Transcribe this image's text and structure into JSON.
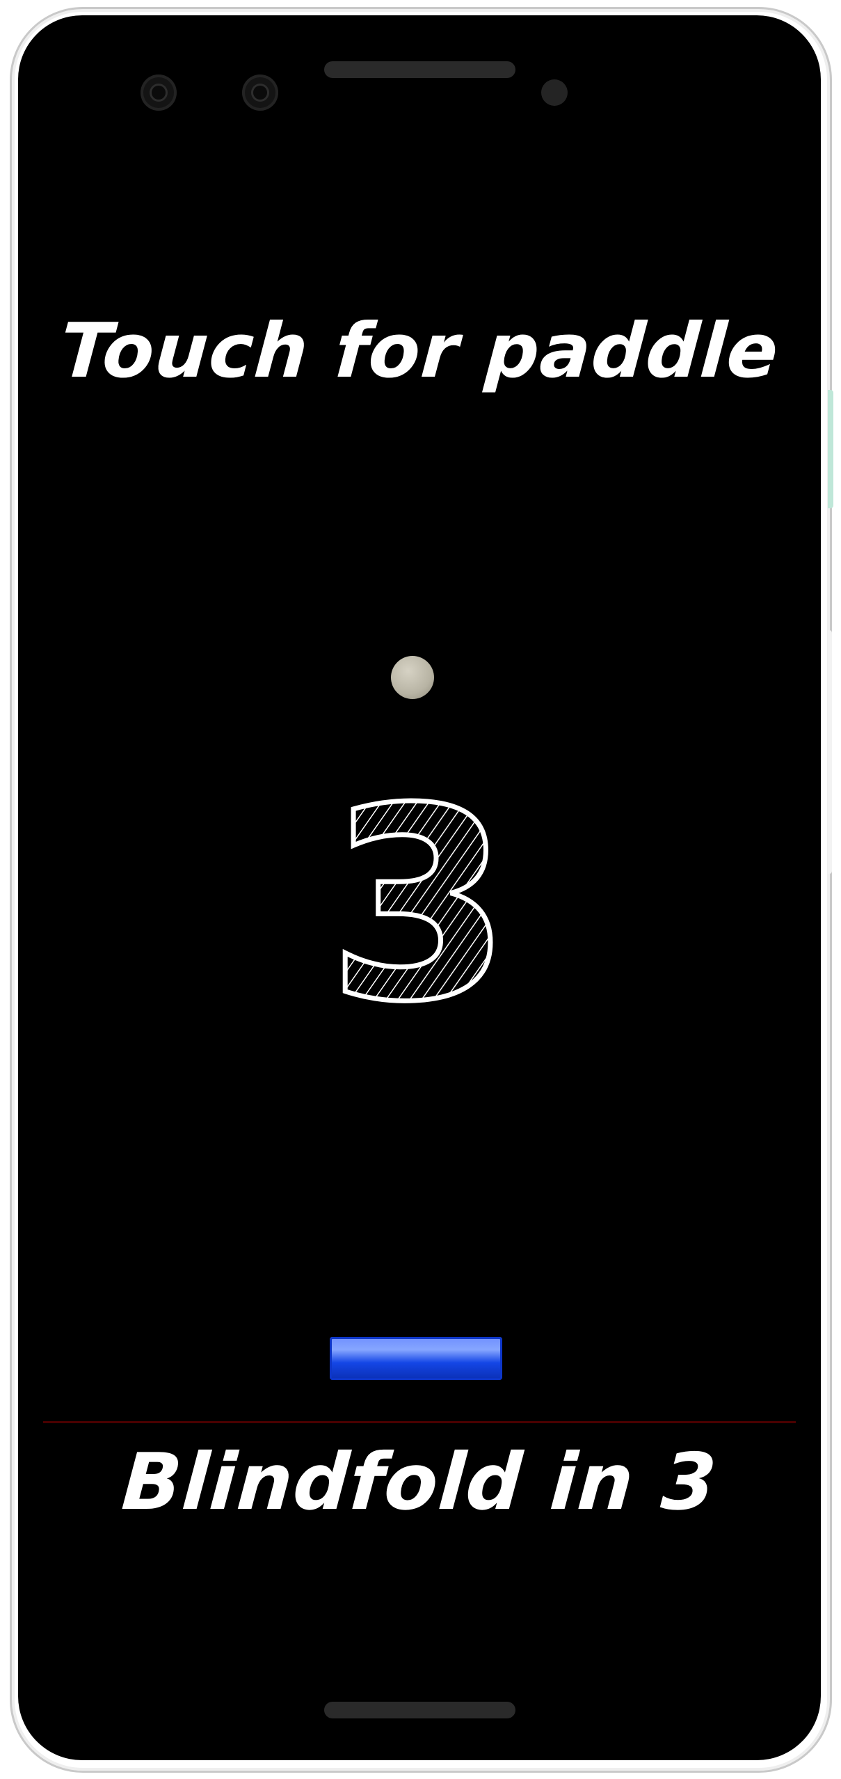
{
  "game": {
    "headline": "Touch for paddle",
    "countdown": "3",
    "status": "Blindfold in 3"
  },
  "colors": {
    "background": "#000000",
    "text": "#ffffff",
    "ball": "#b8b4a4",
    "paddle": "#1446e6",
    "floor_line": "#4a0000"
  }
}
